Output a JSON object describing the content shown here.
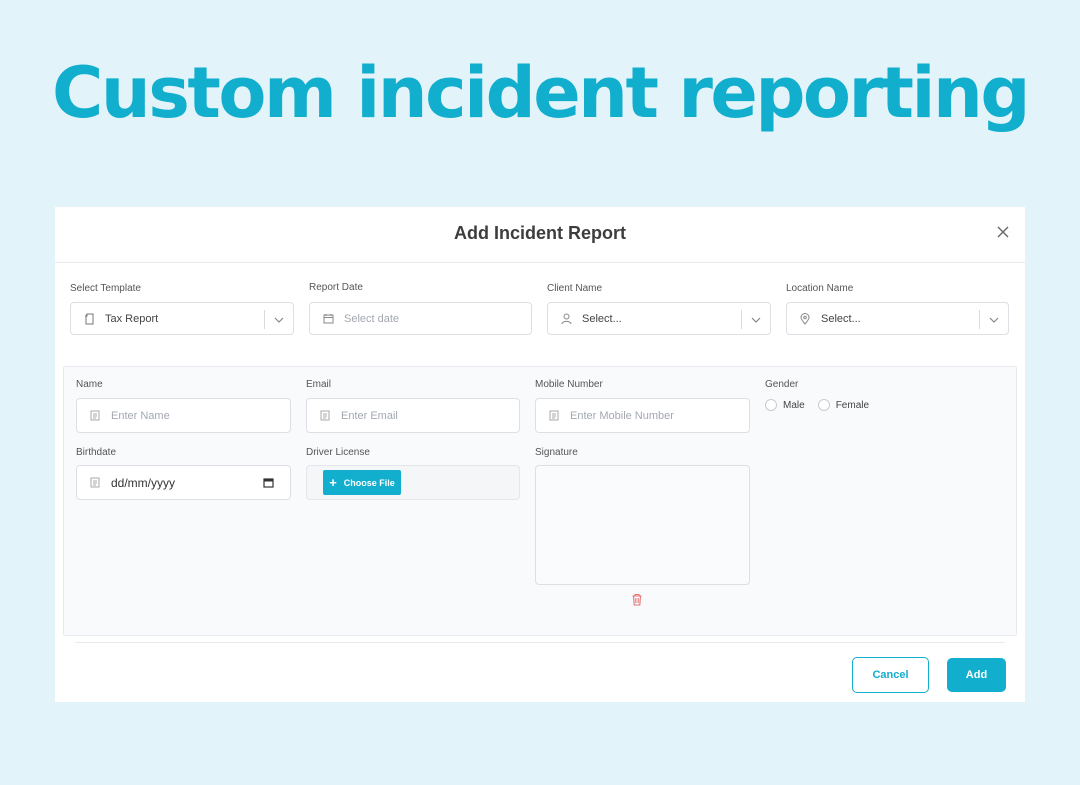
{
  "hero": {
    "title": "Custom incident reporting"
  },
  "modal": {
    "title": "Add Incident Report",
    "top_fields": [
      {
        "label": "Select Template",
        "value": "Tax Report",
        "icon": "document-icon"
      },
      {
        "label": "Report Date",
        "placeholder": "Select date",
        "icon": "calendar-icon"
      },
      {
        "label": "Client Name",
        "placeholder": "Select...",
        "icon": "user-icon"
      },
      {
        "label": "Location Name",
        "placeholder": "Select...",
        "icon": "location-pin-icon"
      }
    ],
    "form": {
      "name": {
        "label": "Name",
        "placeholder": "Enter Name"
      },
      "email": {
        "label": "Email",
        "placeholder": "Enter Email"
      },
      "mobile": {
        "label": "Mobile Number",
        "placeholder": "Enter Mobile Number"
      },
      "gender": {
        "label": "Gender",
        "options": [
          "Male",
          "Female"
        ]
      },
      "birthdate": {
        "label": "Birthdate",
        "placeholder": "dd/mm/yyyy"
      },
      "driver_license": {
        "label": "Driver License",
        "button": "Choose File"
      },
      "signature": {
        "label": "Signature"
      }
    },
    "footer": {
      "cancel": "Cancel",
      "add": "Add"
    }
  },
  "colors": {
    "accent": "#12aecd",
    "background": "#e2f4f9",
    "delete": "#e57373"
  }
}
